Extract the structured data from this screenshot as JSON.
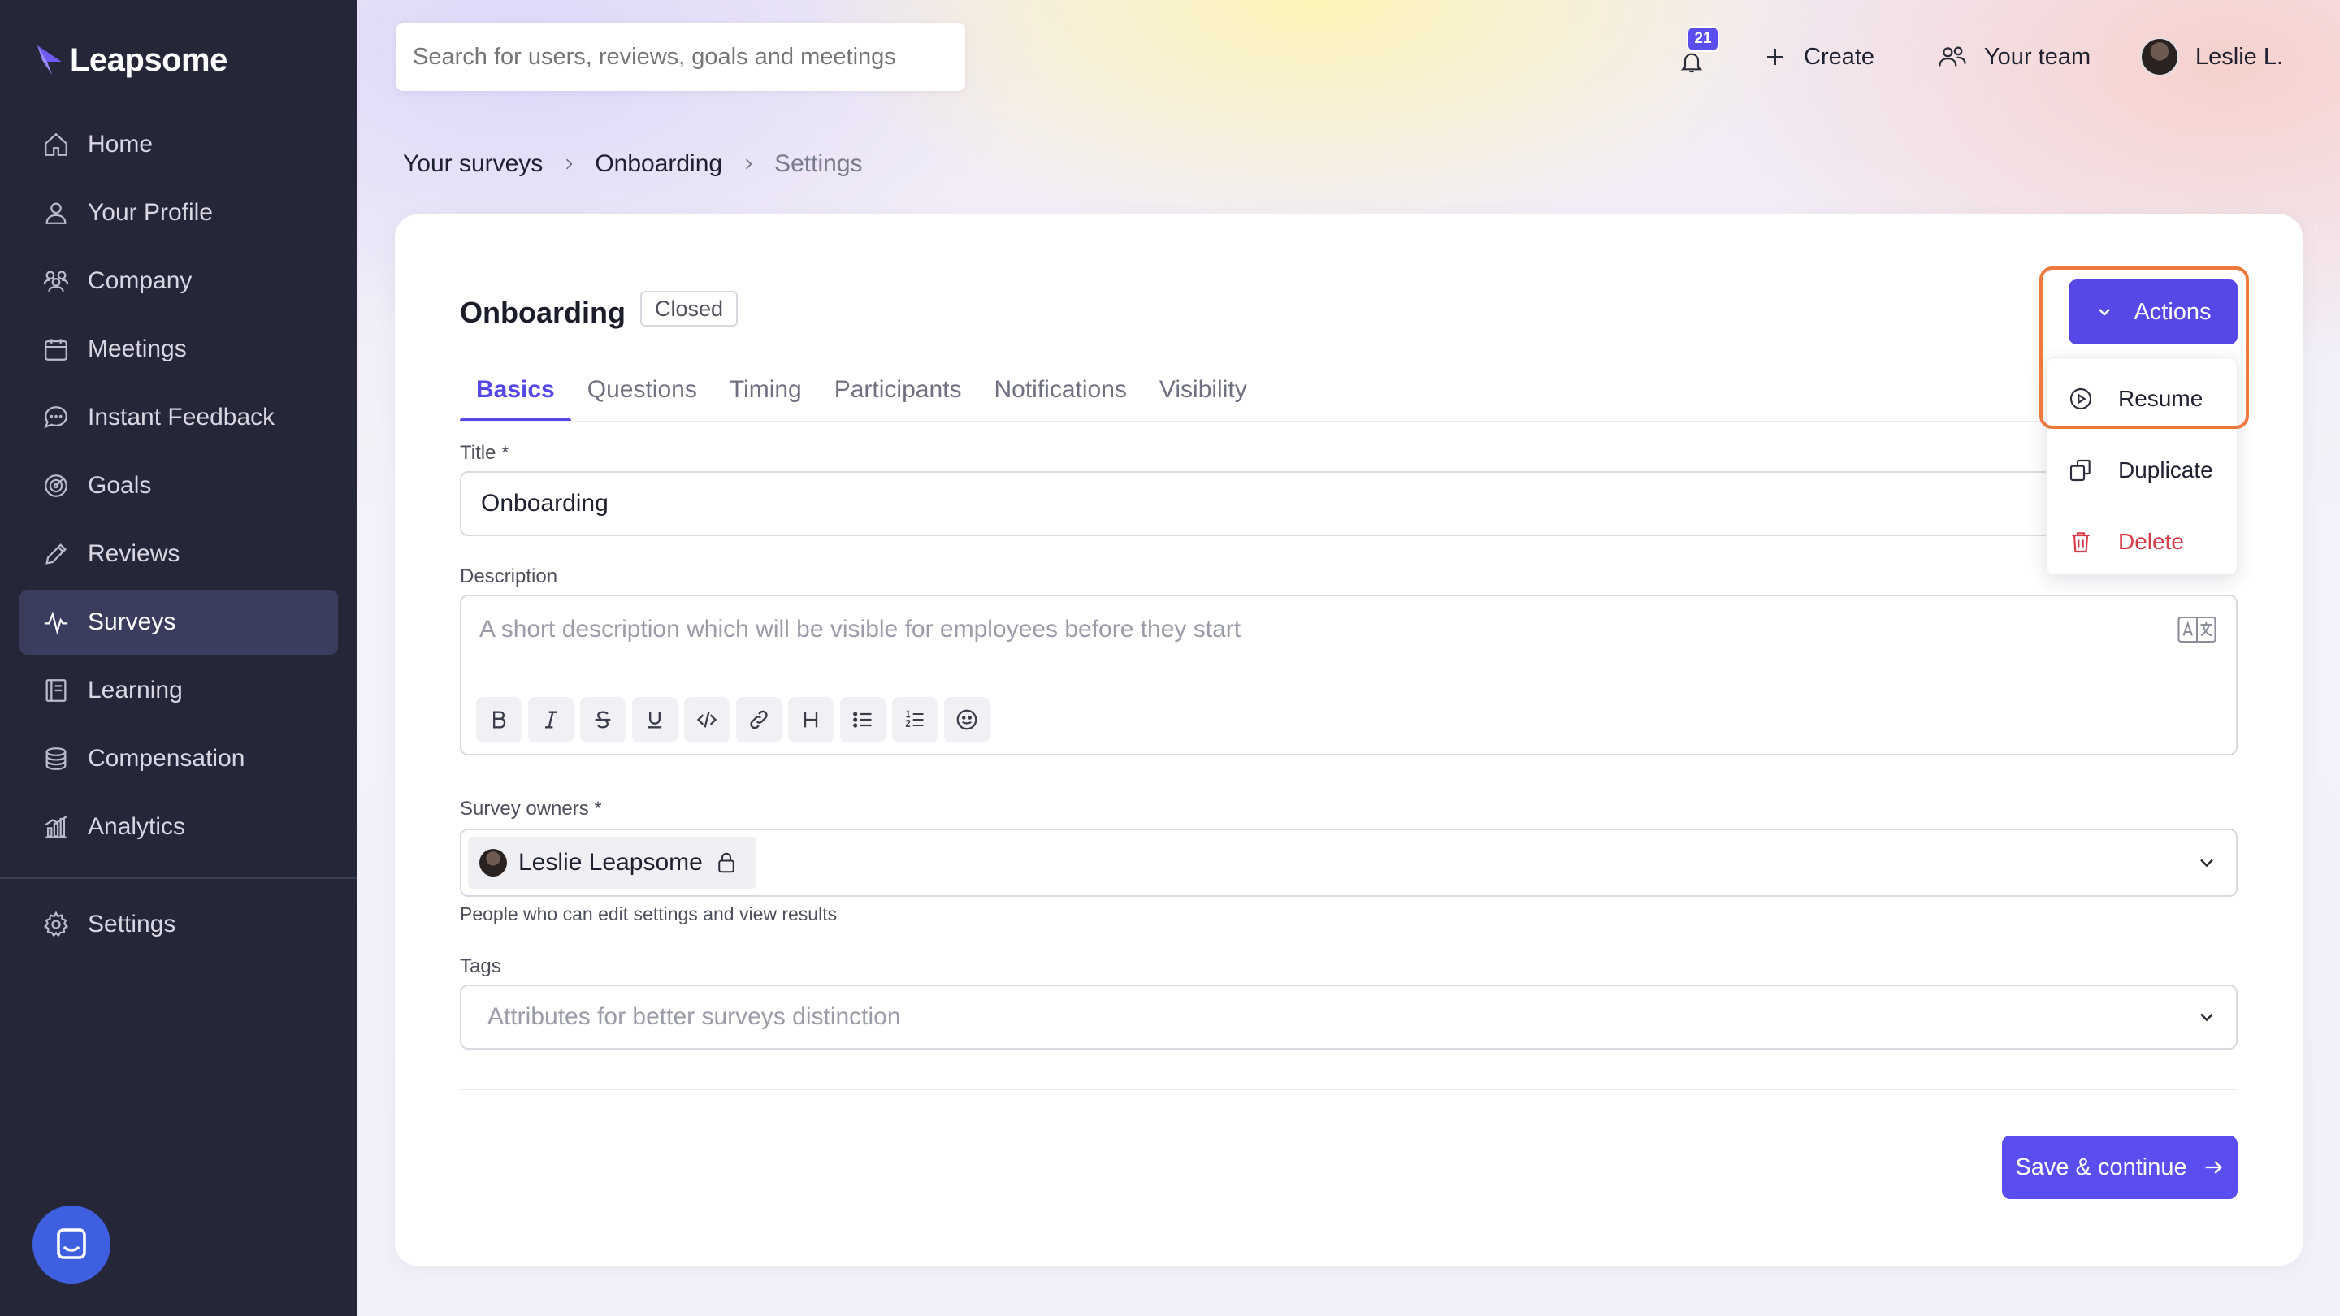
{
  "app": {
    "name": "Leapsome"
  },
  "sidebar": {
    "items": [
      {
        "label": "Home",
        "icon": "home-icon"
      },
      {
        "label": "Your Profile",
        "icon": "user-icon"
      },
      {
        "label": "Company",
        "icon": "people-icon"
      },
      {
        "label": "Meetings",
        "icon": "calendar-icon"
      },
      {
        "label": "Instant Feedback",
        "icon": "chat-icon"
      },
      {
        "label": "Goals",
        "icon": "target-icon"
      },
      {
        "label": "Reviews",
        "icon": "pencil-icon"
      },
      {
        "label": "Surveys",
        "icon": "pulse-icon",
        "active": true
      },
      {
        "label": "Learning",
        "icon": "book-icon"
      },
      {
        "label": "Compensation",
        "icon": "coins-icon"
      },
      {
        "label": "Analytics",
        "icon": "bar-chart-icon"
      }
    ],
    "settings_label": "Settings"
  },
  "topbar": {
    "search_placeholder": "Search for users, reviews, goals and meetings",
    "notifications_count": "21",
    "create_label": "Create",
    "team_label": "Your team",
    "user_name": "Leslie L."
  },
  "breadcrumb": {
    "items": [
      "Your surveys",
      "Onboarding",
      "Settings"
    ]
  },
  "survey": {
    "title": "Onboarding",
    "status": "Closed"
  },
  "tabs": [
    "Basics",
    "Questions",
    "Timing",
    "Participants",
    "Notifications",
    "Visibility"
  ],
  "form": {
    "title_label": "Title *",
    "title_value": "Onboarding",
    "description_label": "Description",
    "description_placeholder": "A short description which will be visible for employees before they start",
    "owners_label": "Survey owners *",
    "owner_name": "Leslie Leapsome",
    "owners_helper": "People who can edit settings and view results",
    "tags_label": "Tags",
    "tags_placeholder": "Attributes for better surveys distinction",
    "save_label": "Save & continue"
  },
  "actions": {
    "button_label": "Actions",
    "menu": [
      {
        "label": "Resume",
        "icon": "play-circle-icon"
      },
      {
        "label": "Duplicate",
        "icon": "copy-icon"
      },
      {
        "label": "Delete",
        "icon": "trash-icon",
        "danger": true
      }
    ]
  },
  "colors": {
    "sidebar_bg": "#252638",
    "accent": "#5648e6",
    "danger": "#d63b48",
    "highlight": "#ec7a3f"
  }
}
